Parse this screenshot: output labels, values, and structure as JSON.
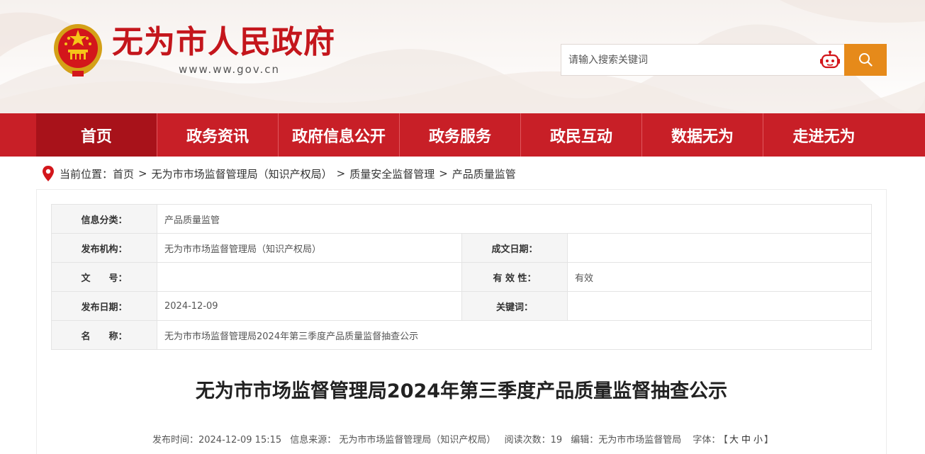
{
  "site": {
    "title": "无为市人民政府",
    "domain": "www.ww.gov.cn"
  },
  "search": {
    "placeholder": "请输入搜索关键词"
  },
  "nav": {
    "items": [
      "首页",
      "政务资讯",
      "政府信息公开",
      "政务服务",
      "政民互动",
      "数据无为",
      "走进无为"
    ]
  },
  "breadcrumb": {
    "prefix": "当前位置：",
    "items": [
      "首页",
      "无为市市场监督管理局（知识产权局）",
      "质量安全监督管理",
      "产品质量监管"
    ],
    "separator": ">"
  },
  "info": {
    "category_label": "信息分类：",
    "category_value": "产品质量监管",
    "publisher_label": "发布机构：",
    "publisher_value": "无为市市场监督管理局（知识产权局）",
    "doc_date_label": "成文日期：",
    "doc_date_value": "",
    "doc_no_label": "文　　号：",
    "doc_no_value": "",
    "validity_label": "有 效 性：",
    "validity_value": "有效",
    "pub_date_label": "发布日期：",
    "pub_date_value": "2024-12-09",
    "keywords_label": "关键词：",
    "keywords_value": "",
    "name_label": "名　　称：",
    "name_value": "无为市市场监督管理局2024年第三季度产品质量监督抽查公示"
  },
  "article": {
    "title": "无为市市场监督管理局2024年第三季度产品质量监督抽查公示",
    "publish_time": "发布时间：2024-12-09 15:15",
    "source": "信息来源： 无为市市场监督管理局（知识产权局）",
    "views": "阅读次数：19",
    "editor": "编辑：无为市市场监督管局",
    "font_label": "字体：",
    "font_open": "【",
    "font_large": "大",
    "font_medium": "中",
    "font_small": "小",
    "font_close": "】"
  },
  "colors": {
    "brand_red": "#c81f27",
    "nav_active": "#a8121a",
    "search_orange": "#e68a1a"
  }
}
